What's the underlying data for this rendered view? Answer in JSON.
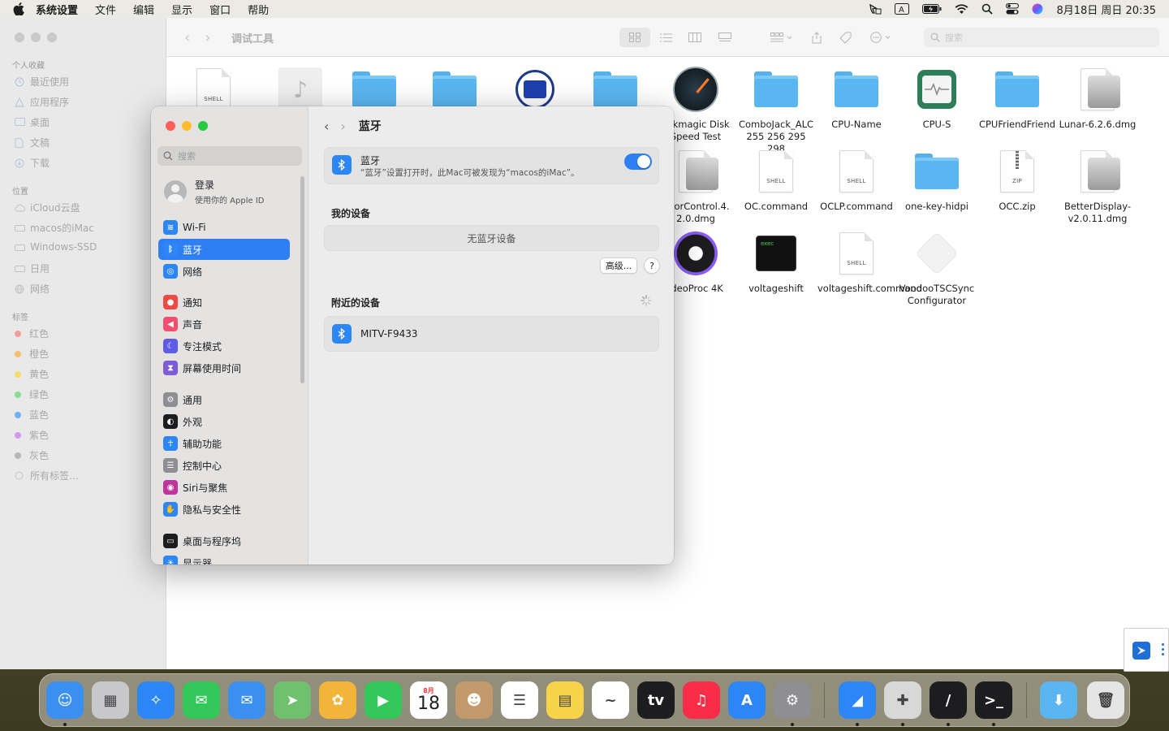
{
  "menubar": {
    "app_name": "系统设置",
    "items": [
      "文件",
      "编辑",
      "显示",
      "窗口",
      "帮助"
    ],
    "datetime": "8月18日 周日  20:35"
  },
  "finder": {
    "title": "调试工具",
    "search_placeholder": "搜索",
    "sidebar": {
      "favorites_header": "个人收藏",
      "favorites": [
        "最近使用",
        "应用程序",
        "桌面",
        "文稿",
        "下载"
      ],
      "locations_header": "位置",
      "locations": [
        "iCloud云盘",
        "macos的iMac",
        "Windows-SSD",
        "日用",
        "网络"
      ],
      "tags_header": "标签",
      "tags": [
        {
          "name": "红色",
          "color": "#ff5f57"
        },
        {
          "name": "橙色",
          "color": "#ff9f0a"
        },
        {
          "name": "黄色",
          "color": "#ffd60a"
        },
        {
          "name": "绿色",
          "color": "#32d74b"
        },
        {
          "name": "蓝色",
          "color": "#0a84ff"
        },
        {
          "name": "紫色",
          "color": "#bf5af2"
        },
        {
          "name": "灰色",
          "color": "#8e8e93"
        }
      ],
      "all_tags": "所有标签…"
    },
    "files": [
      {
        "name": "",
        "type": "shell",
        "badge": "SHELL"
      },
      {
        "name": "",
        "type": "audio"
      },
      {
        "name": "",
        "type": "folder"
      },
      {
        "name": "",
        "type": "folder"
      },
      {
        "name": "",
        "type": "app"
      },
      {
        "name": "",
        "type": "folder"
      },
      {
        "name": "ackmagic Disk Speed Test",
        "type": "gauge"
      },
      {
        "name": "ComboJack_ALC 255 256 295 298",
        "type": "folder"
      },
      {
        "name": "CPU-Name",
        "type": "folder"
      },
      {
        "name": "CPU-S",
        "type": "monitor"
      },
      {
        "name": "CPUFriendFriend",
        "type": "folder"
      },
      {
        "name": "Lunar-6.2.6.dmg",
        "type": "dmg"
      },
      {
        "name": "nitorControl.4. 2.0.dmg",
        "type": "dmg"
      },
      {
        "name": "OC.command",
        "type": "shell",
        "badge": "SHELL"
      },
      {
        "name": "OCLP.command",
        "type": "shell",
        "badge": "SHELL"
      },
      {
        "name": "one-key-hidpi",
        "type": "folder"
      },
      {
        "name": "OCC.zip",
        "type": "zip",
        "badge": "ZIP"
      },
      {
        "name": "BetterDisplay-v2.0.11.dmg",
        "type": "dmg"
      },
      {
        "name": "ideoProc 4K",
        "type": "reel"
      },
      {
        "name": "voltageshift",
        "type": "exec",
        "badge": "exec"
      },
      {
        "name": "voltageshift.command",
        "type": "shell",
        "badge": "SHELL"
      },
      {
        "name": "VoodooTSCSync Configurator",
        "type": "kext"
      }
    ]
  },
  "settings": {
    "search_placeholder": "搜索",
    "account": {
      "name": "登录",
      "subtitle": "使用你的 Apple ID"
    },
    "sidebar_items": [
      {
        "label": "Wi-Fi",
        "color": "#2d86f5",
        "icon": "wifi-icon"
      },
      {
        "label": "蓝牙",
        "color": "#2d86f5",
        "icon": "bluetooth-icon",
        "selected": true
      },
      {
        "label": "网络",
        "color": "#2d86f5",
        "icon": "globe-icon"
      },
      {
        "label": "通知",
        "color": "#f04a42",
        "icon": "bell-icon"
      },
      {
        "label": "声音",
        "color": "#f0506e",
        "icon": "speaker-icon"
      },
      {
        "label": "专注模式",
        "color": "#5e5ce6",
        "icon": "moon-icon"
      },
      {
        "label": "屏幕使用时间",
        "color": "#7d5cd6",
        "icon": "hourglass-icon"
      },
      {
        "label": "通用",
        "color": "#8e8e93",
        "icon": "gear-icon"
      },
      {
        "label": "外观",
        "color": "#1d1d1f",
        "icon": "appearance-icon"
      },
      {
        "label": "辅助功能",
        "color": "#2d86f5",
        "icon": "accessibility-icon"
      },
      {
        "label": "控制中心",
        "color": "#8e8e93",
        "icon": "control-center-icon"
      },
      {
        "label": "Siri与聚焦",
        "color": "#c0359b",
        "icon": "siri-icon"
      },
      {
        "label": "隐私与安全性",
        "color": "#2d86f5",
        "icon": "hand-icon"
      },
      {
        "label": "桌面与程序坞",
        "color": "#1d1d1f",
        "icon": "dock-icon"
      },
      {
        "label": "显示器",
        "color": "#2d86f5",
        "icon": "display-icon"
      }
    ],
    "pane_title": "蓝牙",
    "bluetooth": {
      "title": "蓝牙",
      "desc": "“蓝牙”设置打开时，此Mac可被发现为“macos的iMac”。",
      "enabled": true
    },
    "my_devices_header": "我的设备",
    "no_devices": "无蓝牙设备",
    "advanced_button": "高级...",
    "help_button": "?",
    "nearby_header": "附近的设备",
    "nearby_devices": [
      "MITV-F9433"
    ]
  },
  "dock": {
    "apps": [
      {
        "name": "finder-icon",
        "color": "#3a8ff0",
        "glyph": "☺"
      },
      {
        "name": "launchpad-icon",
        "color": "#c7c7cc",
        "glyph": "▦"
      },
      {
        "name": "safari-icon",
        "color": "#2d86f5",
        "glyph": "✧"
      },
      {
        "name": "messages-icon",
        "color": "#34c759",
        "glyph": "✉"
      },
      {
        "name": "mail-icon",
        "color": "#3a8ff0",
        "glyph": "✉"
      },
      {
        "name": "maps-icon",
        "color": "#6fc16f",
        "glyph": "➤"
      },
      {
        "name": "photos-icon",
        "color": "#f2b53a",
        "glyph": "✿"
      },
      {
        "name": "facetime-icon",
        "color": "#34c759",
        "glyph": "▶"
      },
      {
        "name": "calendar-icon",
        "color": "#ffffff",
        "glyph": "18"
      },
      {
        "name": "contacts-icon",
        "color": "#c49a6c",
        "glyph": "☻"
      },
      {
        "name": "reminders-icon",
        "color": "#ffffff",
        "glyph": "☰"
      },
      {
        "name": "notes-icon",
        "color": "#f7d34a",
        "glyph": "▤"
      },
      {
        "name": "freeform-icon",
        "color": "#ffffff",
        "glyph": "~"
      },
      {
        "name": "tv-icon",
        "color": "#1d1d1f",
        "glyph": "tv"
      },
      {
        "name": "music-icon",
        "color": "#fa2d48",
        "glyph": "♫"
      },
      {
        "name": "app-store-icon",
        "color": "#2d86f5",
        "glyph": "A"
      },
      {
        "name": "system-settings-icon",
        "color": "#8e8e93",
        "glyph": "⚙"
      },
      {
        "name": "remote-icon",
        "color": "#2d86f5",
        "glyph": "◢"
      },
      {
        "name": "disk-utility-icon",
        "color": "#d8d8d8",
        "glyph": "✚"
      },
      {
        "name": "editor-icon",
        "color": "#1d1d1f",
        "glyph": "/"
      },
      {
        "name": "terminal-icon",
        "color": "#1d1d1f",
        "glyph": ">_"
      },
      {
        "name": "downloads-icon",
        "color": "#5ab6f0",
        "glyph": "⬇"
      },
      {
        "name": "trash-icon",
        "color": "#e5e5e5",
        "glyph": "🗑"
      }
    ],
    "calendar_month": "8月",
    "calendar_day": "18"
  }
}
